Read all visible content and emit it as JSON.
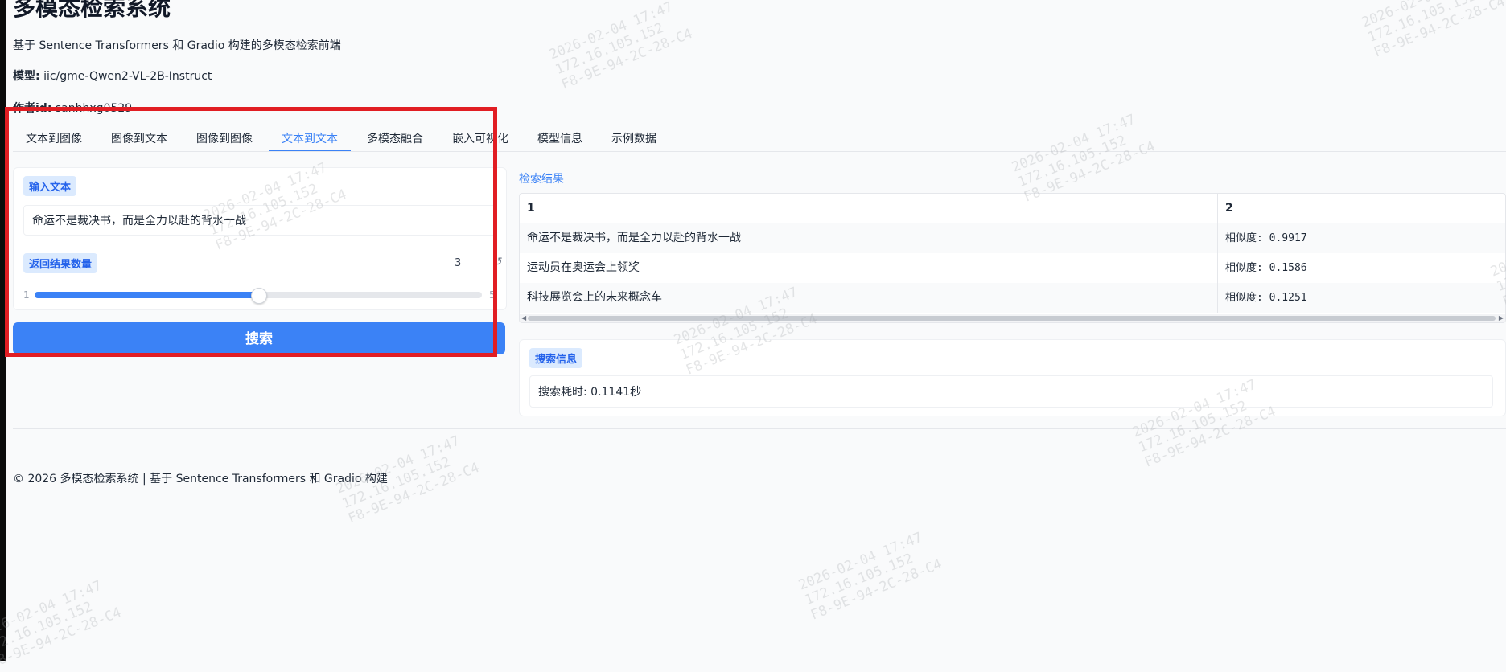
{
  "app": {
    "title": "多模态检索系统",
    "subtitle": "基于 Sentence Transformers 和 Gradio 构建的多模态检索前端",
    "model_label": "模型:",
    "model_value": "iic/gme-Qwen2-VL-2B-Instruct",
    "author_label": "作者id:",
    "author_value": "sanhhxg0529"
  },
  "tabs": [
    {
      "label": "文本到图像",
      "active": false
    },
    {
      "label": "图像到文本",
      "active": false
    },
    {
      "label": "图像到图像",
      "active": false
    },
    {
      "label": "文本到文本",
      "active": true
    },
    {
      "label": "多模态融合",
      "active": false
    },
    {
      "label": "嵌入可视化",
      "active": false
    },
    {
      "label": "模型信息",
      "active": false
    },
    {
      "label": "示例数据",
      "active": false
    }
  ],
  "form": {
    "input_label": "输入文本",
    "input_value": "命运不是裁决书，而是全力以赴的背水一战",
    "count_label": "返回结果数量",
    "count_value": "3",
    "slider_min": "1",
    "slider_max": "5",
    "slider_fraction": 0.5,
    "search_button": "搜索"
  },
  "results": {
    "label": "检索结果",
    "headers": [
      "1",
      "2"
    ],
    "rows": [
      [
        "命运不是裁决书，而是全力以赴的背水一战",
        "相似度: 0.9917"
      ],
      [
        "运动员在奥运会上领奖",
        "相似度: 0.1586"
      ],
      [
        "科技展览会上的未来概念车",
        "相似度: 0.1251"
      ]
    ]
  },
  "info": {
    "label": "搜索信息",
    "text": "搜索耗时: 0.1141秒"
  },
  "footer": "© 2026 多模态检索系统 | 基于 Sentence Transformers 和 Gradio 构建",
  "watermark": [
    "2026-02-04 17:47",
    "172.16.105.152",
    "F8-9E-94-2C-28-C4"
  ],
  "colors": {
    "accent": "#3b82f6",
    "highlight": "#e11d23",
    "chip_bg": "#dbeafe"
  }
}
